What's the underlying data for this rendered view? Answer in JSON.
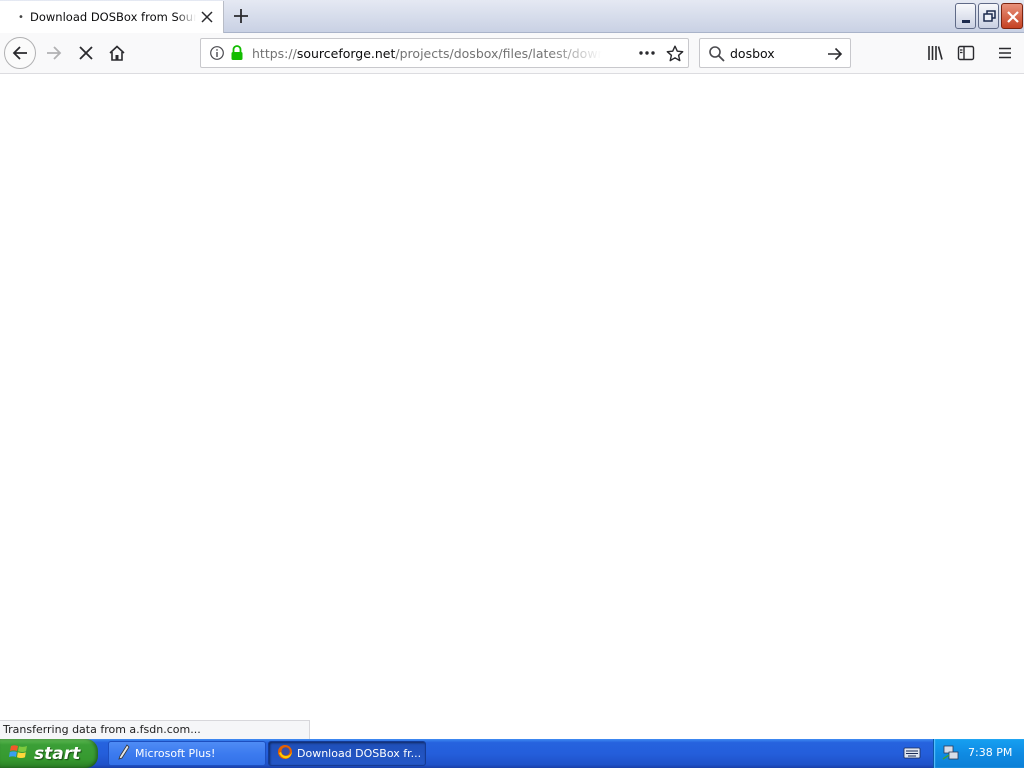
{
  "browser": {
    "tab": {
      "title": "Download DOSBox from SourceForge.net",
      "loading_indicator": "•"
    },
    "urlbar": {
      "scheme": "https://",
      "host": "sourceforge.net",
      "path": "/projects/dosbox/files/latest/download"
    },
    "search": {
      "value": "dosbox"
    },
    "status": "Transferring data from a.fsdn.com..."
  },
  "taskbar": {
    "start_label": "start",
    "tasks": [
      {
        "label": "Microsoft Plus!",
        "icon": "pen-icon",
        "active": false
      },
      {
        "label": "Download DOSBox fr...",
        "icon": "firefox-icon",
        "active": true
      }
    ],
    "clock": "7:38 PM"
  },
  "colors": {
    "lock_green": "#12bc00",
    "taskbar_blue": "#245edb",
    "start_green": "#3b9f37",
    "tray_blue": "#0f8be3"
  }
}
